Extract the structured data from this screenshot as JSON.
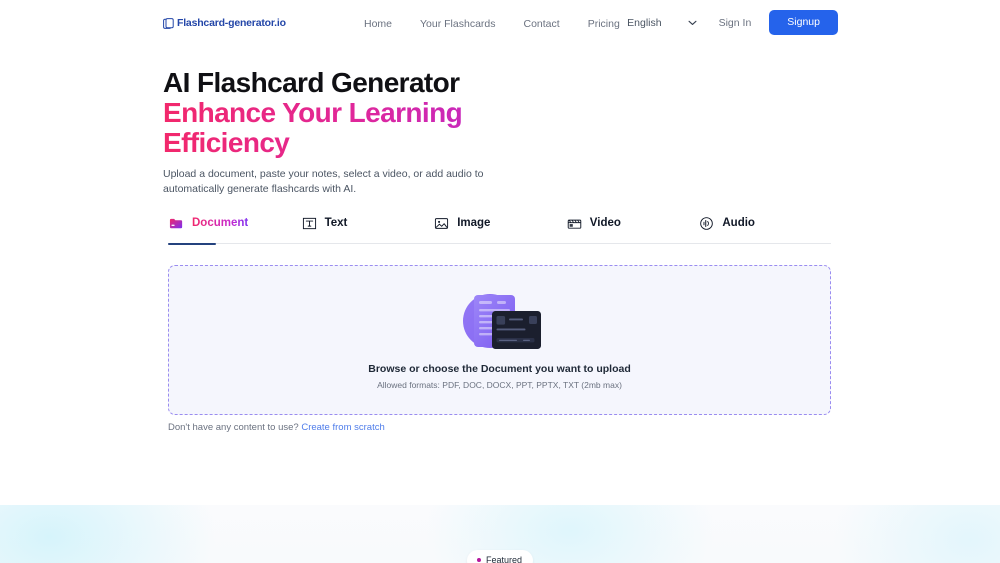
{
  "header": {
    "brand": {
      "name": "Flashcard-generator.io",
      "icon": "flashcard-logo-icon"
    },
    "nav": [
      {
        "label": "Home"
      },
      {
        "label": "Your Flashcards"
      },
      {
        "label": "Contact"
      },
      {
        "label": "Pricing"
      }
    ],
    "language": {
      "value": "English",
      "icon": "chevron-down-icon"
    },
    "sign_in_label": "Sign In",
    "signup_label": "Signup",
    "signup_color": "#2563eb"
  },
  "hero": {
    "title_line1": "AI Flashcard Generator",
    "title_line2": "Enhance Your Learning",
    "title_line3": "Efficiency",
    "gradient_from": "#f2286b",
    "gradient_to": "#6d2ef0",
    "subtitle": "Upload a document, paste your notes, select a video, or add audio to automatically generate flashcards with AI."
  },
  "tabs": [
    {
      "label": "Document",
      "icon": "folder-icon",
      "active": true
    },
    {
      "label": "Text",
      "icon": "text-box-icon",
      "active": false
    },
    {
      "label": "Image",
      "icon": "image-icon",
      "active": false
    },
    {
      "label": "Video",
      "icon": "video-clapper-icon",
      "active": false
    },
    {
      "label": "Audio",
      "icon": "audio-wave-icon",
      "active": false
    }
  ],
  "dropzone": {
    "illustration": "document-upload-illustration",
    "title": "Browse or choose the Document you want to upload",
    "formats": "Allowed formats: PDF, DOC, DOCX, PPT, PPTX, TXT (2mb max)",
    "border_color": "#9a8cf0",
    "background_color": "#f5f6fd"
  },
  "scratch": {
    "prompt": "Don't have any content to use?",
    "link_label": "Create from scratch",
    "link_color": "#4f7dea"
  },
  "featured": {
    "label": "Featured",
    "dot_color": "#b5179e"
  }
}
